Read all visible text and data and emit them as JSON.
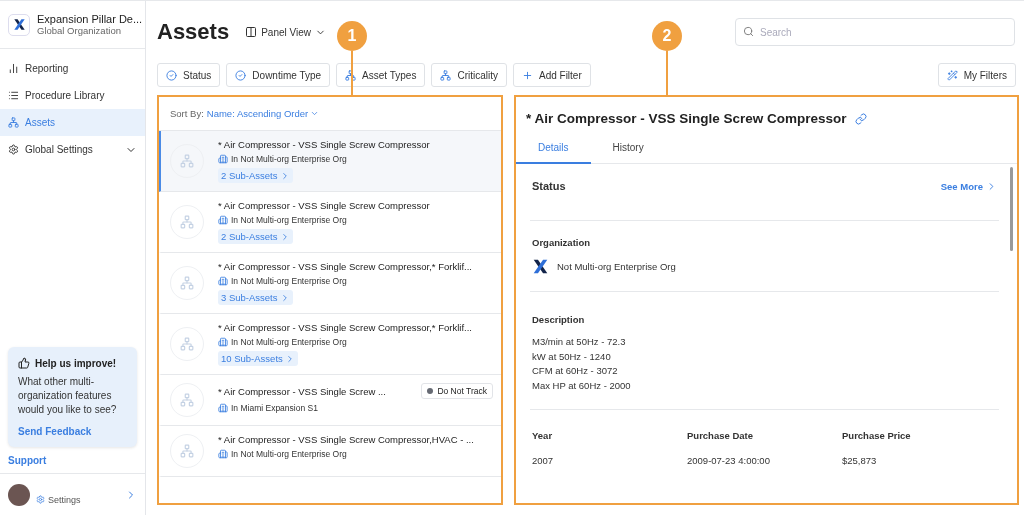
{
  "sidebar": {
    "org_name": "Expansion Pillar De...",
    "org_subtitle": "Global Organization",
    "items": [
      {
        "label": "Reporting",
        "kind": "chart",
        "selected": false,
        "expandable": false
      },
      {
        "label": "Procedure Library",
        "kind": "list",
        "selected": false,
        "expandable": false
      },
      {
        "label": "Assets",
        "kind": "hierarchy",
        "selected": true,
        "expandable": false
      },
      {
        "label": "Global Settings",
        "kind": "gear",
        "selected": false,
        "expandable": true
      }
    ],
    "feedback": {
      "title": "Help us improve!",
      "text": "What other multi-organization features would you like to see?",
      "link": "Send Feedback"
    },
    "support": "Support",
    "user_settings": "Settings"
  },
  "header": {
    "title": "Assets",
    "view": "Panel View",
    "search": {
      "placeholder": "Search"
    }
  },
  "filters": [
    {
      "label": "Status",
      "kind": "check"
    },
    {
      "label": "Downtime Type",
      "kind": "check"
    },
    {
      "label": "Asset Types",
      "kind": "hierarchy"
    },
    {
      "label": "Criticality",
      "kind": "hierarchy"
    },
    {
      "label": "Add Filter",
      "kind": "plus"
    }
  ],
  "my_filters": "My Filters",
  "list": {
    "sort_label": "Sort By:",
    "sort_value": "Name: Ascending Order",
    "items": [
      {
        "name": "* Air Compressor - VSS Single Screw Compressor",
        "location": "In Not Multi-org Enterprise Org",
        "sub_assets": "2 Sub-Assets",
        "selected": true
      },
      {
        "name": "* Air Compressor - VSS Single Screw Compressor",
        "location": "In Not Multi-org Enterprise Org",
        "sub_assets": "2 Sub-Assets",
        "selected": false
      },
      {
        "name": "* Air Compressor - VSS Single Screw Compressor,* Forklif...",
        "location": "In Not Multi-org Enterprise Org",
        "sub_assets": "3 Sub-Assets",
        "selected": false
      },
      {
        "name": "* Air Compressor - VSS Single Screw Compressor,* Forklif...",
        "location": "In Not Multi-org Enterprise Org",
        "sub_assets": "10 Sub-Assets",
        "selected": false
      },
      {
        "name": "* Air Compressor - VSS Single Screw ...",
        "location": "In Miami Expansion S1",
        "badge": "Do Not Track",
        "selected": false
      },
      {
        "name": "* Air Compressor - VSS Single Screw Compressor,HVAC - ...",
        "location": "In Not Multi-org Enterprise Org",
        "selected": false
      }
    ]
  },
  "detail": {
    "title": "* Air Compressor - VSS Single Screw Compressor",
    "tabs": [
      {
        "label": "Details",
        "selected": true
      },
      {
        "label": "History",
        "selected": false
      }
    ],
    "status_label": "Status",
    "see_more": "See More",
    "organization_label": "Organization",
    "organization": "Not Multi-org Enterprise Org",
    "description_label": "Description",
    "description": [
      "M3/min at 50Hz - 72.3",
      "kW at 50Hz - 1240",
      "CFM at 60Hz - 3072",
      "Max HP at 60Hz - 2000"
    ],
    "fields": [
      {
        "label": "Year",
        "value": "2007"
      },
      {
        "label": "Purchase Date",
        "value": "2009-07-23 4:00:00"
      },
      {
        "label": "Purchase Price",
        "value": "$25,873"
      }
    ]
  },
  "callouts": [
    "1",
    "2"
  ]
}
